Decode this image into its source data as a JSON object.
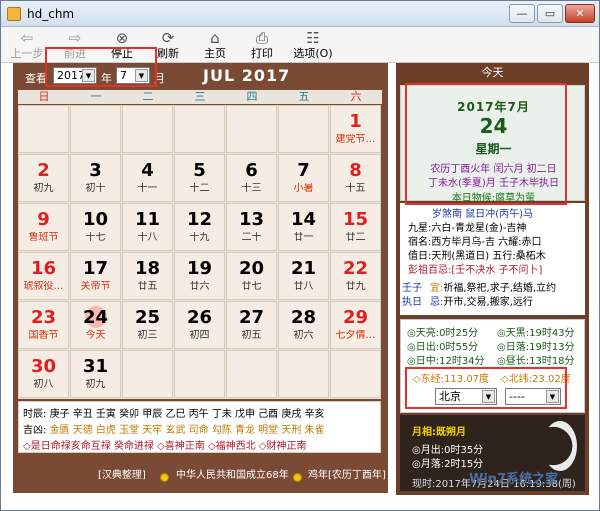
{
  "window": {
    "title": "hd_chm",
    "btn_min": "—",
    "btn_max": "▭",
    "btn_close": "✕"
  },
  "toolbar": {
    "back": "上一步",
    "forward": "前进",
    "stop": "停止",
    "refresh": "刷新",
    "home": "主页",
    "print": "打印",
    "options": "选项(O)"
  },
  "calendar": {
    "query_label": "查看",
    "year": "2017",
    "year_label": "年",
    "month": "7",
    "month_label": "月",
    "month_title": "JUL 2017",
    "weekdays": [
      "日",
      "一",
      "二",
      "三",
      "四",
      "五",
      "六"
    ],
    "cells": [
      {
        "d": "",
        "s": ""
      },
      {
        "d": "",
        "s": ""
      },
      {
        "d": "",
        "s": ""
      },
      {
        "d": "",
        "s": ""
      },
      {
        "d": "",
        "s": ""
      },
      {
        "d": "",
        "s": ""
      },
      {
        "d": "1",
        "s": "建党节…"
      },
      {
        "d": "2",
        "s": "初九"
      },
      {
        "d": "3",
        "s": "初十"
      },
      {
        "d": "4",
        "s": "十一"
      },
      {
        "d": "5",
        "s": "十二"
      },
      {
        "d": "6",
        "s": "十三"
      },
      {
        "d": "7",
        "s": "小暑"
      },
      {
        "d": "8",
        "s": "十五"
      },
      {
        "d": "9",
        "s": "鲁班节"
      },
      {
        "d": "10",
        "s": "十七"
      },
      {
        "d": "11",
        "s": "十八"
      },
      {
        "d": "12",
        "s": "十九"
      },
      {
        "d": "13",
        "s": "二十"
      },
      {
        "d": "14",
        "s": "廿一"
      },
      {
        "d": "15",
        "s": "廿二"
      },
      {
        "d": "16",
        "s": "琥叙役…"
      },
      {
        "d": "17",
        "s": "关帝节"
      },
      {
        "d": "18",
        "s": "廿五"
      },
      {
        "d": "19",
        "s": "廿六"
      },
      {
        "d": "20",
        "s": "廿七"
      },
      {
        "d": "21",
        "s": "廿八"
      },
      {
        "d": "22",
        "s": "廿九"
      },
      {
        "d": "23",
        "s": "国香节"
      },
      {
        "d": "24",
        "s": "今天"
      },
      {
        "d": "25",
        "s": "初三"
      },
      {
        "d": "26",
        "s": "初四"
      },
      {
        "d": "27",
        "s": "初五"
      },
      {
        "d": "28",
        "s": "初六"
      },
      {
        "d": "29",
        "s": "七夕情…"
      },
      {
        "d": "30",
        "s": "初八"
      },
      {
        "d": "31",
        "s": "初九"
      },
      {
        "d": "",
        "s": ""
      },
      {
        "d": "",
        "s": ""
      },
      {
        "d": "",
        "s": ""
      },
      {
        "d": "",
        "s": ""
      },
      {
        "d": "",
        "s": ""
      }
    ],
    "shichen_label": "时辰:",
    "shichen": "庚子 辛丑 壬寅 癸卯 甲辰 乙巳 丙午 丁未 戊申 己酉 庚戌 辛亥",
    "jixiong_label": "吉凶:",
    "jixiong": "金匮 天德 白虎 玉堂 天牢 玄武 司命 勾陈 青龙 明堂 天刑 朱雀",
    "notes": "◇是日命禄亥命互禄 癸命进禄 ◇喜神正南 ◇福神西北 ◇财神正南",
    "footer_org": "[汉典整理]",
    "footer_years": "中华人民共和国成立68年",
    "footer_suifan": "鸡年[农历丁酉年]"
  },
  "today": {
    "header": "今天",
    "ym": "2017年7月",
    "day": "24",
    "weekday": "星期一",
    "lunar1": "农历丁酉火年 闰六月 初二日",
    "lunar2": "丁未水(季夏)月 壬子木毕执日",
    "wuhou": "本日物候:腐草为萤",
    "almanac": [
      "岁煞南  鼠日冲(丙午)马",
      "九星:六白-青龙星(金)-吉神",
      "宿名:西方毕月乌-吉 六耀:赤口",
      "值日:天刑(黑道日) 五行:桑柘木",
      "彭祖百忌:[壬不决水 子不问卜]"
    ],
    "yi_label": "宜:",
    "yi": "祈福,祭祀,求子,结婚,立约",
    "ji_label": "忌:",
    "ji": "开市,交易,搬家,远行",
    "side1": "壬子",
    "side2": "执日",
    "sun": [
      "◎天亮:0时25分",
      "◎天黑:19时43分",
      "◎日出:0时55分",
      "◎日落:19时13分",
      "◎日中:12时34分",
      "◎昼长:13时18分"
    ],
    "longitude": "◇东经:113.07度",
    "latitude": "◇北纬:23.02度",
    "province": "北京",
    "city": "----",
    "moon_title": "月相:既朔月",
    "moonrise": "◎月出:0时35分",
    "moonset": "◎月落:2时15分",
    "moontime": "◎时:20时55分",
    "clock": "现时:2017年7月24日 16:19:38(周)"
  },
  "watermark": "Win7系统之家",
  "colors": {
    "accent": "#e8302b",
    "frame": "#7a4a34"
  }
}
